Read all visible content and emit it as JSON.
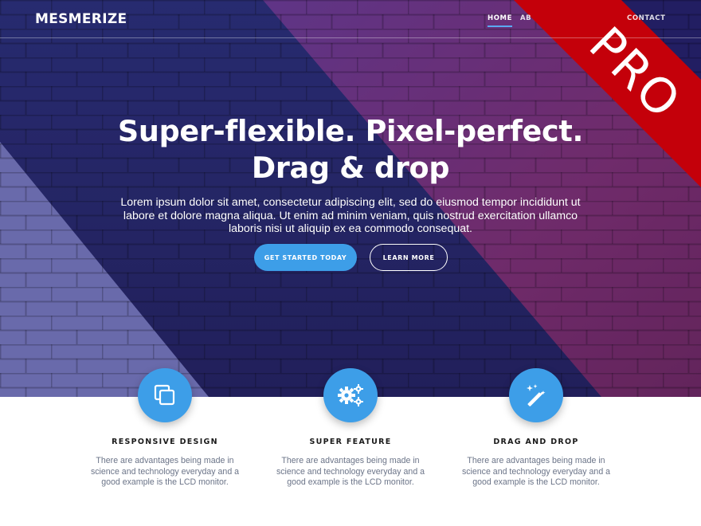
{
  "header": {
    "logo": "MESMERIZE",
    "nav": [
      {
        "label": "HOME"
      },
      {
        "label": "AB"
      },
      {
        "label": "CONTACT"
      }
    ],
    "ribbon": "PRO"
  },
  "hero": {
    "title_line1": "Super-flexible. Pixel-perfect.",
    "title_line2": "Drag & drop",
    "text": "Lorem ipsum dolor sit amet, consectetur adipiscing elit, sed do eiusmod tempor incididunt ut labore et dolore magna aliqua. Ut enim ad minim veniam, quis nostrud exercitation ullamco laboris nisi ut aliquip ex ea commodo consequat.",
    "primary_button": "GET STARTED TODAY",
    "secondary_button": "LEARN MORE"
  },
  "features": [
    {
      "icon": "copy-icon",
      "title": "RESPONSIVE DESIGN",
      "text": "There are advantages being made in science and technology everyday and a good example is the LCD monitor."
    },
    {
      "icon": "gears-icon",
      "title": "SUPER FEATURE",
      "text": "There are advantages being made in science and technology everyday and a good example is the LCD monitor."
    },
    {
      "icon": "magic-wand-icon",
      "title": "DRAG AND DROP",
      "text": "There are advantages being made in science and technology everyday and a good example is the LCD monitor."
    }
  ],
  "colors": {
    "accent": "#3d9ee8",
    "hero_navy": "#27266a",
    "hero_magenta": "#7a2d6e",
    "ribbon_red": "#c4000a"
  }
}
